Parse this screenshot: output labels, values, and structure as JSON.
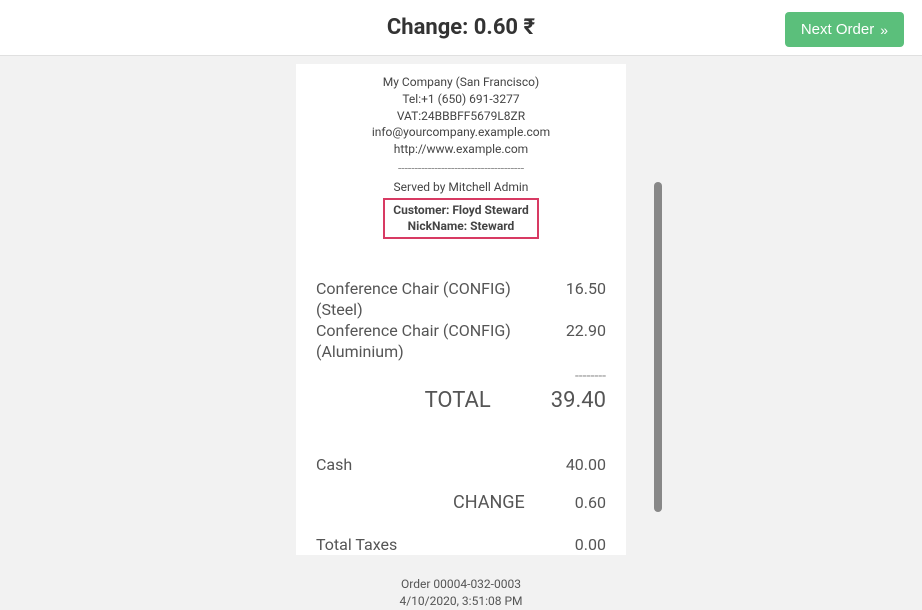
{
  "header": {
    "change_label": "Change: 0.60 ₹",
    "next_order_label": "Next Order"
  },
  "receipt": {
    "company": "My Company (San Francisco)",
    "tel": "Tel:+1 (650) 691-3277",
    "vat": "VAT:24BBBFF5679L8ZR",
    "email": "info@yourcompany.example.com",
    "website": "http://www.example.com",
    "separator": "--------------------------------------",
    "served_by": "Served by Mitchell Admin",
    "customer": "Customer: Floyd Steward",
    "nickname": "NickName: Steward",
    "items": [
      {
        "name": "Conference Chair (CONFIG) (Steel)",
        "price": "16.50"
      },
      {
        "name": "Conference Chair (CONFIG) (Aluminium)",
        "price": "22.90"
      }
    ],
    "right_dashes": "--------",
    "total_label": "TOTAL",
    "total_value": "39.40",
    "payment_method": "Cash",
    "payment_amount": "40.00",
    "change_label": "CHANGE",
    "change_value": "0.60",
    "taxes_label": "Total Taxes",
    "taxes_value": "0.00",
    "order_id": "Order 00004-032-0003",
    "order_date": "4/10/2020, 3:51:08 PM"
  }
}
